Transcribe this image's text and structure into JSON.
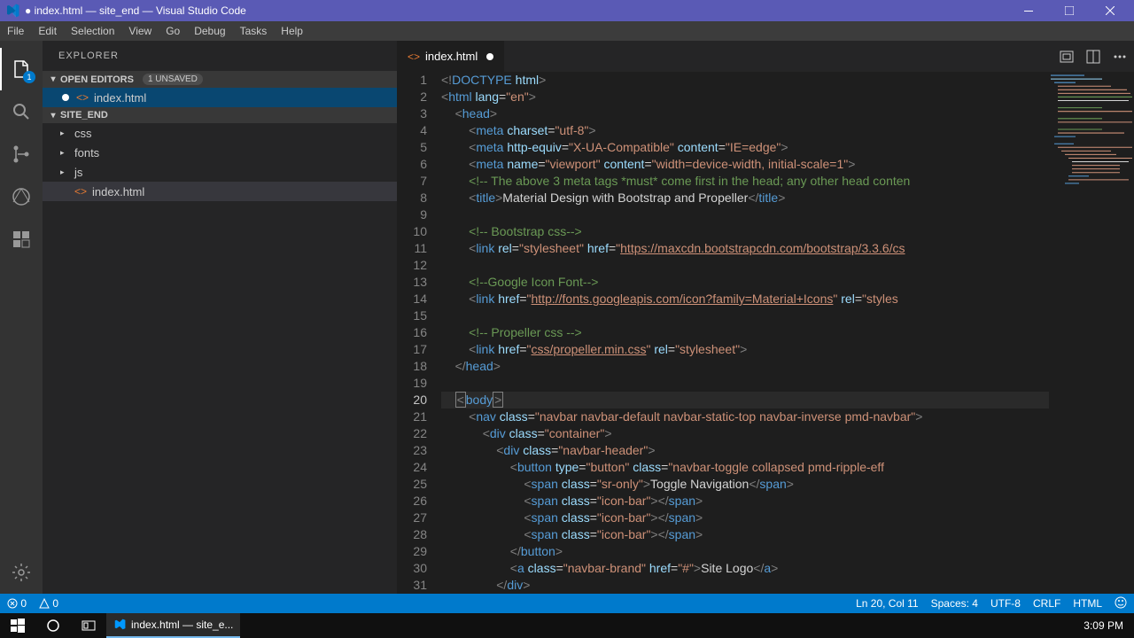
{
  "window": {
    "title": "● index.html — site_end — Visual Studio Code"
  },
  "menu": [
    "File",
    "Edit",
    "Selection",
    "View",
    "Go",
    "Debug",
    "Tasks",
    "Help"
  ],
  "activitybar": {
    "explorer_badge": "1"
  },
  "sidebar": {
    "title": "EXPLORER",
    "openEditors": {
      "label": "OPEN EDITORS",
      "badge": "1 UNSAVED"
    },
    "openEditorItems": [
      {
        "label": "index.html",
        "icon": "<>"
      }
    ],
    "folder": "SITE_END",
    "tree": [
      {
        "label": "css",
        "kind": "folder"
      },
      {
        "label": "fonts",
        "kind": "folder"
      },
      {
        "label": "js",
        "kind": "folder"
      },
      {
        "label": "index.html",
        "kind": "file",
        "icon": "<>"
      }
    ]
  },
  "tab": {
    "label": "index.html",
    "icon": "<>"
  },
  "code": {
    "lines": [
      {
        "n": 1,
        "html": "<span class='c-cl'>&lt;!</span><span class='c-elem'>DOCTYPE</span> <span class='c-attr'>html</span><span class='c-cl'>&gt;</span>"
      },
      {
        "n": 2,
        "html": "<span class='c-cl'>&lt;</span><span class='c-elem'>html</span> <span class='c-attr'>lang</span>=<span class='c-str'>\"en\"</span><span class='c-cl'>&gt;</span>"
      },
      {
        "n": 3,
        "html": "    <span class='c-cl'>&lt;</span><span class='c-elem'>head</span><span class='c-cl'>&gt;</span>"
      },
      {
        "n": 4,
        "html": "        <span class='c-cl'>&lt;</span><span class='c-elem'>meta</span> <span class='c-attr'>charset</span>=<span class='c-str'>\"utf-8\"</span><span class='c-cl'>&gt;</span>"
      },
      {
        "n": 5,
        "html": "        <span class='c-cl'>&lt;</span><span class='c-elem'>meta</span> <span class='c-attr'>http-equiv</span>=<span class='c-str'>\"X-UA-Compatible\"</span> <span class='c-attr'>content</span>=<span class='c-str'>\"IE=edge\"</span><span class='c-cl'>&gt;</span>"
      },
      {
        "n": 6,
        "html": "        <span class='c-cl'>&lt;</span><span class='c-elem'>meta</span> <span class='c-attr'>name</span>=<span class='c-str'>\"viewport\"</span> <span class='c-attr'>content</span>=<span class='c-str'>\"width=device-width, initial-scale=1\"</span><span class='c-cl'>&gt;</span>"
      },
      {
        "n": 7,
        "html": "        <span class='c-comment'>&lt;!-- The above 3 meta tags *must* come first in the head; any other head conten</span>"
      },
      {
        "n": 8,
        "html": "        <span class='c-cl'>&lt;</span><span class='c-elem'>title</span><span class='c-cl'>&gt;</span><span class='c-text'>Material Design with Bootstrap and Propeller</span><span class='c-cl'>&lt;/</span><span class='c-elem'>title</span><span class='c-cl'>&gt;</span>"
      },
      {
        "n": 9,
        "html": ""
      },
      {
        "n": 10,
        "html": "        <span class='c-comment'>&lt;!-- Bootstrap css--&gt;</span>"
      },
      {
        "n": 11,
        "html": "        <span class='c-cl'>&lt;</span><span class='c-elem'>link</span> <span class='c-attr'>rel</span>=<span class='c-str'>\"stylesheet\"</span> <span class='c-attr'>href</span>=<span class='c-str'>\"</span><span class='c-url'>https://maxcdn.bootstrapcdn.com/bootstrap/3.3.6/cs</span>"
      },
      {
        "n": 12,
        "html": ""
      },
      {
        "n": 13,
        "html": "        <span class='c-comment'>&lt;!--Google Icon Font--&gt;</span>"
      },
      {
        "n": 14,
        "html": "        <span class='c-cl'>&lt;</span><span class='c-elem'>link</span> <span class='c-attr'>href</span>=<span class='c-str'>\"</span><span class='c-url'>http://fonts.googleapis.com/icon?family=Material+Icons</span><span class='c-str'>\"</span> <span class='c-attr'>rel</span>=<span class='c-str'>\"styles</span>"
      },
      {
        "n": 15,
        "html": ""
      },
      {
        "n": 16,
        "html": "        <span class='c-comment'>&lt;!-- Propeller css --&gt;</span>"
      },
      {
        "n": 17,
        "html": "        <span class='c-cl'>&lt;</span><span class='c-elem'>link</span> <span class='c-attr'>href</span>=<span class='c-str'>\"</span><span class='c-url'>css/propeller.min.css</span><span class='c-str'>\"</span> <span class='c-attr'>rel</span>=<span class='c-str'>\"stylesheet\"</span><span class='c-cl'>&gt;</span>"
      },
      {
        "n": 18,
        "html": "    <span class='c-cl'>&lt;/</span><span class='c-elem'>head</span><span class='c-cl'>&gt;</span>"
      },
      {
        "n": 19,
        "html": ""
      },
      {
        "n": 20,
        "cur": true,
        "html": "    <span class='bracket-box c-cl'>&lt;</span><span class='c-elem'>body</span><span class='bracket-box c-cl'>&gt;</span>"
      },
      {
        "n": 21,
        "html": "        <span class='c-cl'>&lt;</span><span class='c-elem'>nav</span> <span class='c-attr'>class</span>=<span class='c-str'>\"navbar navbar-default navbar-static-top navbar-inverse pmd-navbar\"</span><span class='c-cl'>&gt;</span>"
      },
      {
        "n": 22,
        "html": "            <span class='c-cl'>&lt;</span><span class='c-elem'>div</span> <span class='c-attr'>class</span>=<span class='c-str'>\"container\"</span><span class='c-cl'>&gt;</span>"
      },
      {
        "n": 23,
        "html": "                <span class='c-cl'>&lt;</span><span class='c-elem'>div</span> <span class='c-attr'>class</span>=<span class='c-str'>\"navbar-header\"</span><span class='c-cl'>&gt;</span>"
      },
      {
        "n": 24,
        "html": "                    <span class='c-cl'>&lt;</span><span class='c-elem'>button</span> <span class='c-attr'>type</span>=<span class='c-str'>\"button\"</span> <span class='c-attr'>class</span>=<span class='c-str'>\"navbar-toggle collapsed pmd-ripple-eff</span>"
      },
      {
        "n": 25,
        "html": "                        <span class='c-cl'>&lt;</span><span class='c-elem'>span</span> <span class='c-attr'>class</span>=<span class='c-str'>\"sr-only\"</span><span class='c-cl'>&gt;</span><span class='c-text'>Toggle Navigation</span><span class='c-cl'>&lt;/</span><span class='c-elem'>span</span><span class='c-cl'>&gt;</span>"
      },
      {
        "n": 26,
        "html": "                        <span class='c-cl'>&lt;</span><span class='c-elem'>span</span> <span class='c-attr'>class</span>=<span class='c-str'>\"icon-bar\"</span><span class='c-cl'>&gt;&lt;/</span><span class='c-elem'>span</span><span class='c-cl'>&gt;</span>"
      },
      {
        "n": 27,
        "html": "                        <span class='c-cl'>&lt;</span><span class='c-elem'>span</span> <span class='c-attr'>class</span>=<span class='c-str'>\"icon-bar\"</span><span class='c-cl'>&gt;&lt;/</span><span class='c-elem'>span</span><span class='c-cl'>&gt;</span>"
      },
      {
        "n": 28,
        "html": "                        <span class='c-cl'>&lt;</span><span class='c-elem'>span</span> <span class='c-attr'>class</span>=<span class='c-str'>\"icon-bar\"</span><span class='c-cl'>&gt;&lt;/</span><span class='c-elem'>span</span><span class='c-cl'>&gt;</span>"
      },
      {
        "n": 29,
        "html": "                    <span class='c-cl'>&lt;/</span><span class='c-elem'>button</span><span class='c-cl'>&gt;</span>"
      },
      {
        "n": 30,
        "html": "                    <span class='c-cl'>&lt;</span><span class='c-elem'>a</span> <span class='c-attr'>class</span>=<span class='c-str'>\"navbar-brand\"</span> <span class='c-attr'>href</span>=<span class='c-str'>\"#\"</span><span class='c-cl'>&gt;</span><span class='c-text'>Site Logo</span><span class='c-cl'>&lt;/</span><span class='c-elem'>a</span><span class='c-cl'>&gt;</span>"
      },
      {
        "n": 31,
        "html": "                <span class='c-cl'>&lt;/</span><span class='c-elem'>div</span><span class='c-cl'>&gt;</span>"
      }
    ]
  },
  "statusbar": {
    "errors": "0",
    "warnings": "0",
    "position": "Ln 20, Col 11",
    "spaces": "Spaces: 4",
    "encoding": "UTF-8",
    "eol": "CRLF",
    "lang": "HTML"
  },
  "taskbar": {
    "app": "index.html — site_e...",
    "time": "3:09 PM"
  }
}
